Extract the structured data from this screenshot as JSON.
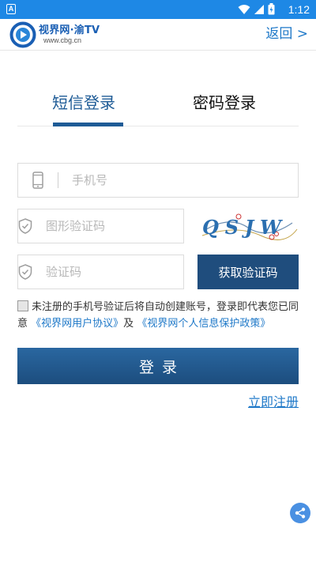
{
  "status_bar": {
    "notification_glyph": "A",
    "time": "1:12",
    "icons": [
      "wifi-icon",
      "signal-icon",
      "battery-icon"
    ]
  },
  "header": {
    "logo_title": "视界网·渝TV",
    "logo_url": "www.cbg.cn",
    "back_label": "返回 >"
  },
  "tabs": [
    {
      "label": "短信登录",
      "active": true
    },
    {
      "label": "密码登录",
      "active": false
    }
  ],
  "form": {
    "phone_placeholder": "手机号",
    "captcha_placeholder": "图形验证码",
    "captcha_text": "QSJW",
    "code_placeholder": "验证码",
    "get_code_label": "获取验证码"
  },
  "agreement": {
    "checked": false,
    "text_before": "未注册的手机号验证后将自动创建账号，登录即代表您已同意",
    "user_agreement": "《视界网用户协议》",
    "and_text": "及",
    "privacy_policy": "《视界网个人信息保护政策》"
  },
  "login_label": "登录",
  "register_label": "立即注册",
  "colors": {
    "status_bar": "#1e88e5",
    "primary": "#1e5b96",
    "link": "#1e78c8",
    "button": "#1f4d7d"
  }
}
